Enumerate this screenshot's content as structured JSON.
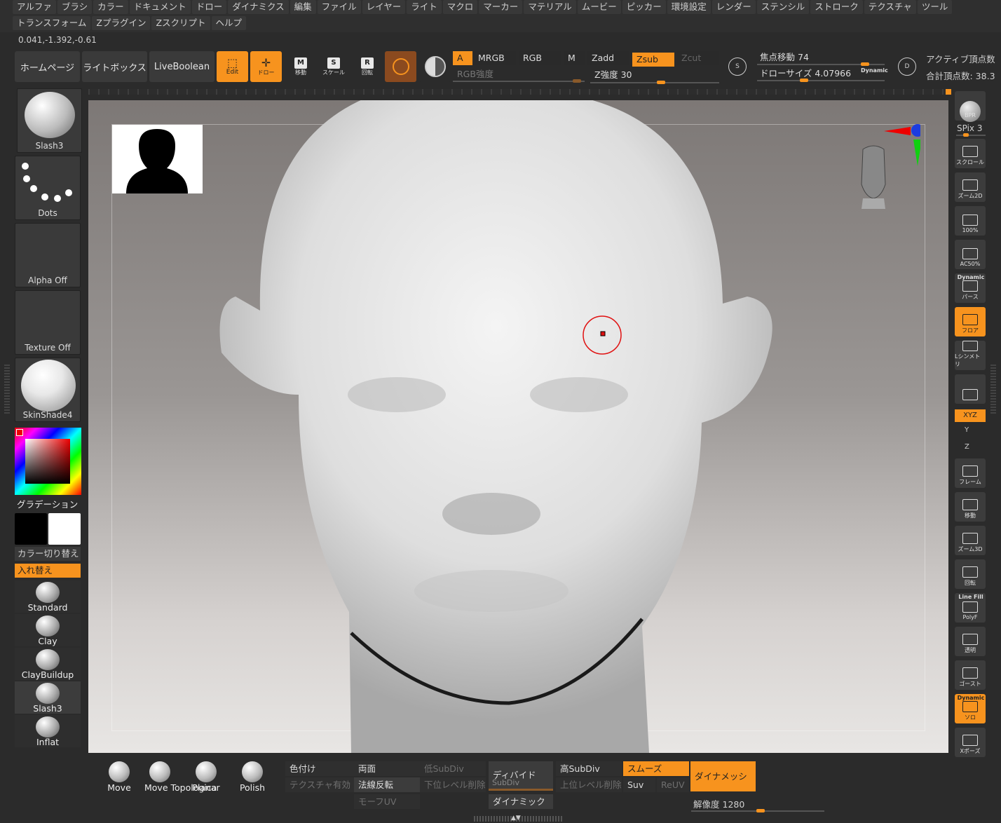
{
  "menu": {
    "row1": [
      "アルファ",
      "ブラシ",
      "カラー",
      "ドキュメント",
      "ドロー",
      "ダイナミクス",
      "編集",
      "ファイル",
      "レイヤー",
      "ライト",
      "マクロ",
      "マーカー",
      "マテリアル",
      "ムービー",
      "ピッカー",
      "環境設定",
      "レンダー",
      "ステンシル",
      "ストローク",
      "テクスチャ",
      "ツール"
    ],
    "row2": [
      "トランスフォーム",
      "Zプラグイン",
      "Zスクリプト",
      "ヘルプ"
    ]
  },
  "coords": "0.041,-1.392,-0.61",
  "toolbar": {
    "home": "ホームページ",
    "lightbox": "ライトボックス",
    "liveboolean": "LiveBoolean",
    "edit": "Edit",
    "draw": "ドロー",
    "move": "移動",
    "scale": "スケール",
    "rotate": "回転",
    "a_label": "A",
    "mrgb": "MRGB",
    "rgb": "RGB",
    "m": "M",
    "zadd": "Zadd",
    "zsub": "Zsub",
    "zcut": "Zcut",
    "rgb_intensity": "RGB強度",
    "z_intensity_label": "Z強度",
    "z_intensity_value": "30",
    "focal_shift_label": "焦点移動",
    "focal_shift_value": "74",
    "draw_size_label": "ドローサイズ",
    "draw_size_value": "4.07966",
    "dynamic": "Dynamic",
    "active_points": "アクティブ頂点数",
    "total_points": "合計頂点数: 38.3"
  },
  "left": {
    "brush": "Slash3",
    "stroke": "Dots",
    "alpha": "Alpha Off",
    "texture": "Texture Off",
    "material": "SkinShade4",
    "gradient": "グラデーション",
    "color_switch": "カラー切り替え",
    "swap": "入れ替え",
    "brushes": [
      "Standard",
      "Clay",
      "ClayBuildup",
      "Slash3",
      "Inflat"
    ]
  },
  "right": {
    "bpr": "BPR",
    "spix": "SPix 3",
    "scroll": "スクロール",
    "zoom2d": "ズーム2D",
    "pct100": "100%",
    "ac50": "AC50%",
    "dynamic": "Dynamic",
    "perspective": "パース",
    "floor": "フロア",
    "local_sym": "Lシンメトリ",
    "xyz": "XYZ",
    "y": "Y",
    "z": "Z",
    "frame": "フレーム",
    "move": "移動",
    "zoom3d": "ズーム3D",
    "rotate": "回転",
    "linefill": "Line Fill",
    "polyf": "PolyF",
    "transp": "透明",
    "ghost": "ゴースト",
    "solo_dynamic": "Dynamic",
    "solo": "ソロ",
    "xpose": "Xポーズ"
  },
  "bottom": {
    "brushes": [
      "Move",
      "Move Topologica",
      "Planar",
      "Polish"
    ],
    "colorize": "色付け",
    "double": "両面",
    "low_subdiv": "低SubDiv",
    "texture_on": "テクスチャ有効",
    "flip": "法線反転",
    "del_lower": "下位レベル削除",
    "morph_uv": "モーフUV",
    "divide": "ディバイド",
    "subdiv": "SubDiv",
    "dynamic": "ダイナミック",
    "high_subdiv": "高SubDiv",
    "del_higher": "上位レベル削除",
    "smooth": "スムーズ",
    "suv": "Suv",
    "reuv": "ReUV",
    "dynamesh": "ダイナメッシュ",
    "resolution_label": "解像度",
    "resolution_value": "1280"
  },
  "colors": {
    "accent": "#f7931e",
    "panel": "#3a3a3a"
  },
  "sliders": {
    "rgb_intensity": 0.97,
    "z_intensity": 0.55,
    "focal_shift": 0.87,
    "draw_size": 0.36,
    "spix": 0.3,
    "resolution": 0.52
  }
}
